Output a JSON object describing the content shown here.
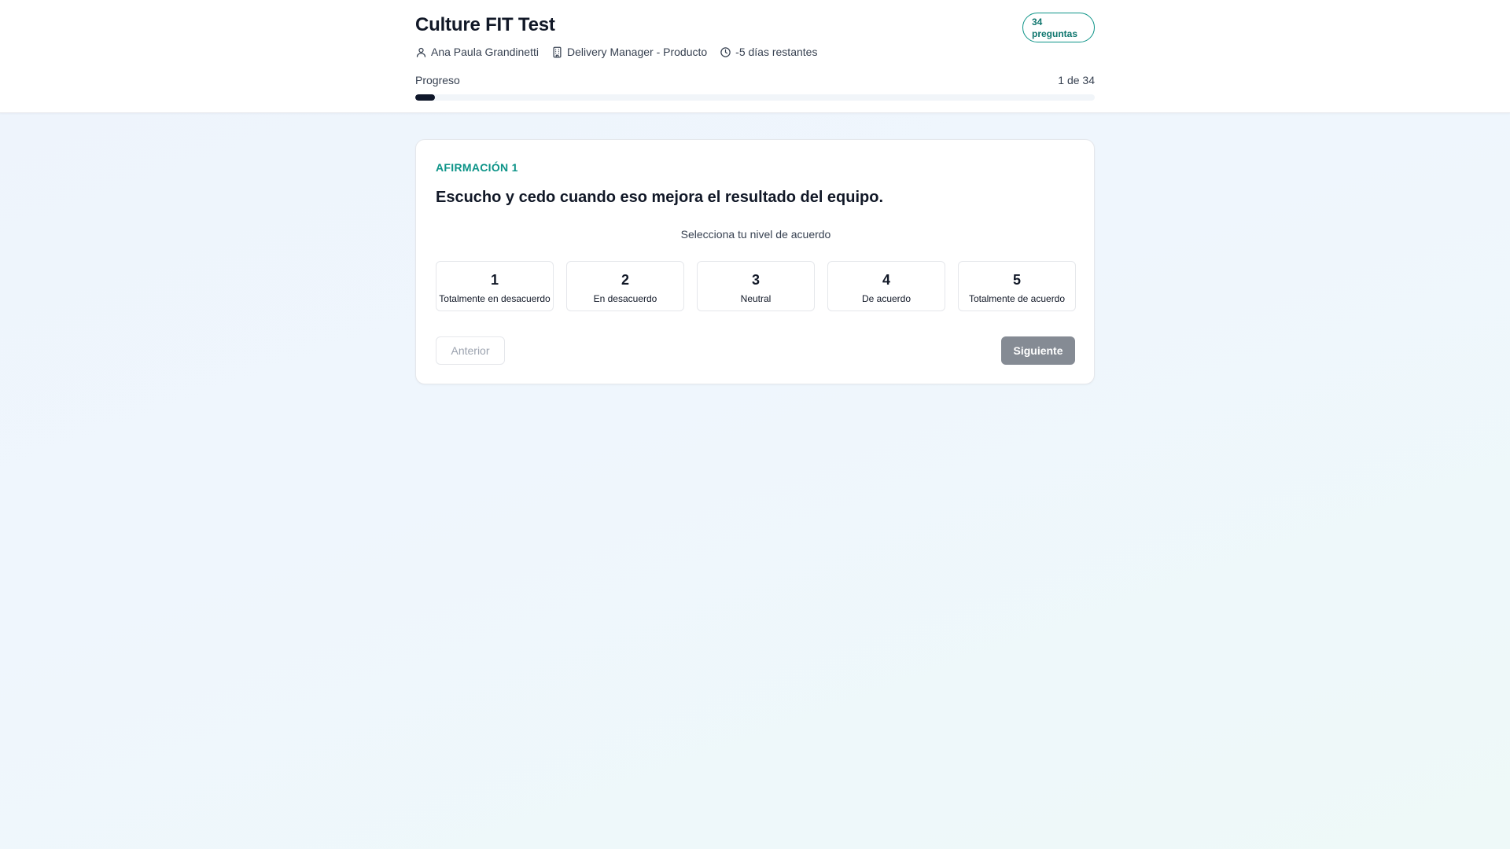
{
  "header": {
    "title": "Culture FIT Test",
    "badge": "34\npreguntas",
    "meta": {
      "candidate": "Ana Paula Grandinetti",
      "position": "Delivery Manager - Producto",
      "time_remaining": "-5 días restantes"
    },
    "progress": {
      "label": "Progreso",
      "count": "1 de 34",
      "fraction": 0.0294
    }
  },
  "question": {
    "eyebrow": "AFIRMACIÓN 1",
    "statement": "Escucho y cedo cuando eso mejora el resultado del equipo.",
    "scale_hint": "Selecciona tu nivel de acuerdo",
    "options": [
      {
        "value": "1",
        "label": "Totalmente en desacuerdo"
      },
      {
        "value": "2",
        "label": "En desacuerdo"
      },
      {
        "value": "3",
        "label": "Neutral"
      },
      {
        "value": "4",
        "label": "De acuerdo"
      },
      {
        "value": "5",
        "label": "Totalmente de acuerdo"
      }
    ]
  },
  "nav": {
    "prev_label": "Anterior",
    "next_label": "Siguiente"
  },
  "icons": {
    "candidate": "user-icon",
    "position": "building-icon",
    "time": "clock-icon"
  },
  "colors": {
    "accent": "#0d9488",
    "progress_fill": "#0f172a",
    "next_button_disabled": "#858b94"
  }
}
